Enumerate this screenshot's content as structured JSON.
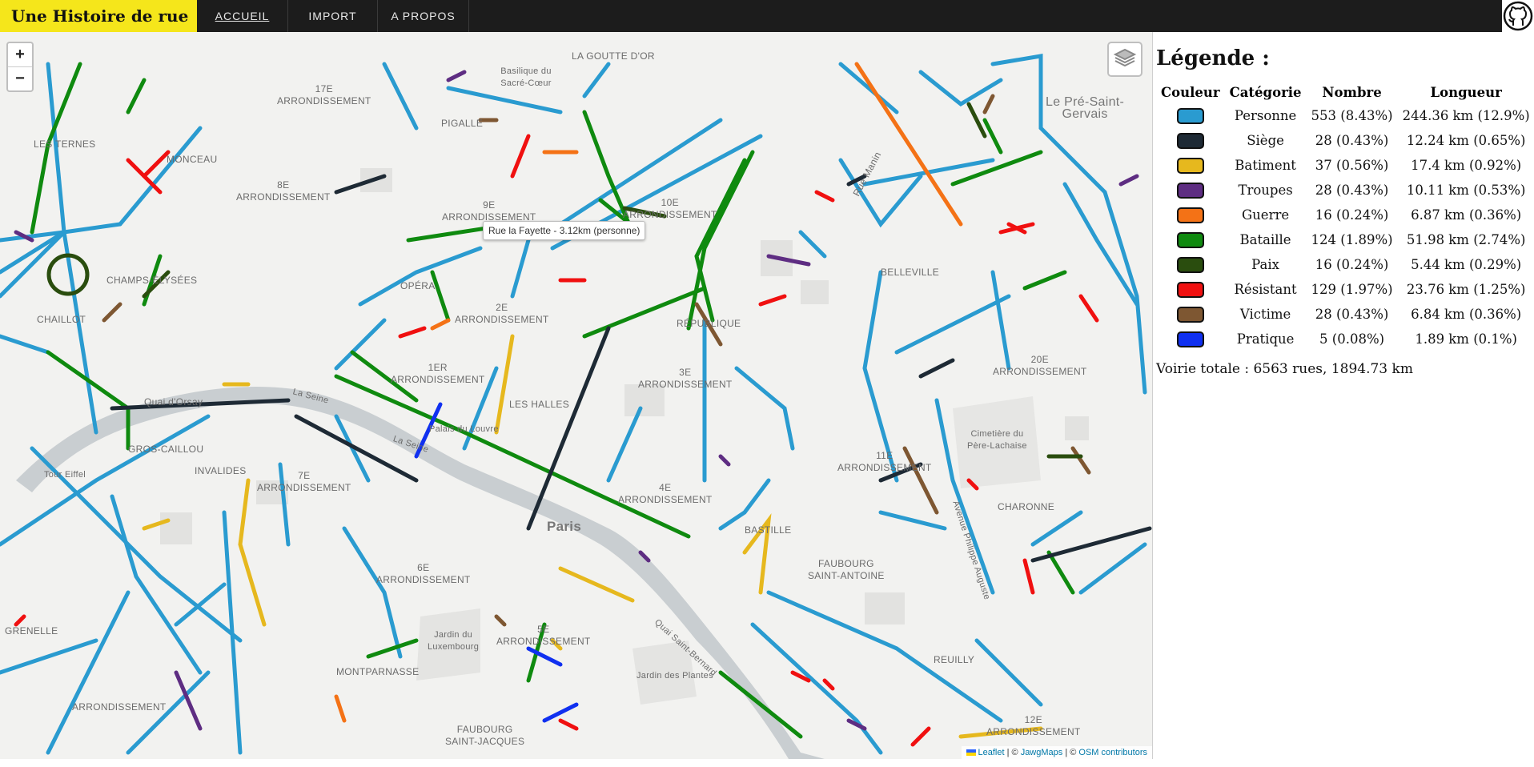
{
  "nav": {
    "brand": "Une Histoire de rue",
    "links": [
      "ACCUEIL",
      "IMPORT",
      "A PROPOS"
    ]
  },
  "map": {
    "zoom_in": "+",
    "zoom_out": "−",
    "tooltip": "Rue la Fayette - 3.12km (personne)",
    "attribution": {
      "leaflet": "Leaflet",
      "sep1": " | © ",
      "jawg": "JawgMaps",
      "sep2": " | © ",
      "osm": "OSM contributors"
    },
    "labels": {
      "goutte": "LA GOUTTE D'OR",
      "sacre_coeur": "Basilique du\nSacré-Cœur",
      "arr17": "17E\nARRONDISSEMENT",
      "pigalle": "PIGALLE",
      "ternes": "LES TERNES",
      "monceau": "MONCEAU",
      "arr8": "8E\nARRONDISSEMENT",
      "arr9": "9E\nARRONDISSEMENT",
      "arr10": "10E\nARRONDISSEMENT",
      "pre_st_gervais": "Le Pré-Saint-\nGervais",
      "rue_manin": "Rue Manin",
      "belleville": "BELLEVILLE",
      "champs": "CHAMPS-ÉLYSÉES",
      "opera": "OPÉRA",
      "arr2": "2E\nARRONDISSEMENT",
      "republique": "RÉPUBLIQUE",
      "chaillot": "CHAILLOT",
      "arr1": "1ER\nARRONDISSEMENT",
      "arr3": "3E\nARRONDISSEMENT",
      "arr20": "20E\nARRONDISSEMENT",
      "quai_orsay": "Quai d'Orsay",
      "la_seine": "La Seine",
      "la_seine2": "La Seine",
      "louvre": "Palais du Louvre",
      "halles": "LES HALLES",
      "pere_lachaise": "Cimetière du\nPère-Lachaise",
      "gros_caillou": "GROS-CAILLOU",
      "tour_eiffel": "Tour Eiffel",
      "invalides": "INVALIDES",
      "arr7": "7E\nARRONDISSEMENT",
      "arr11": "11E\nARRONDISSEMENT",
      "arr4": "4E\nARRONDISSEMENT",
      "philippe": "Avenue Philippe Auguste",
      "charonne": "CHARONNE",
      "paris": "Paris",
      "bastille": "BASTILLE",
      "arr6": "6E\nARRONDISSEMENT",
      "faubourg_st_antoine": "FAUBOURG\nSAINT-ANTOINE",
      "grenelle": "GRENELLE",
      "luxembourg": "Jardin du\nLuxembourg",
      "arr5": "5E\nARRONDISSEMENT",
      "quai_bernard": "Quai Saint-Bernard",
      "reuilly": "REUILLY",
      "montparnasse": "MONTPARNASSE",
      "jardin_plantes": "Jardin des Plantes",
      "arr15": "ARRONDISSEMENT",
      "faubourg_st_jacques": "FAUBOURG\nSAINT-JACQUES",
      "arr12": "12E\nARRONDISSEMENT"
    }
  },
  "legend": {
    "title": "Légende :",
    "headers": [
      "Couleur",
      "Catégorie",
      "Nombre",
      "Longueur"
    ],
    "rows": [
      {
        "color": "#2a9bd0",
        "category": "Personne",
        "count": "553 (8.43%)",
        "length": "244.36 km (12.9%)"
      },
      {
        "color": "#1e2a35",
        "category": "Siège",
        "count": "28 (0.43%)",
        "length": "12.24 km (0.65%)"
      },
      {
        "color": "#e6b81e",
        "category": "Batiment",
        "count": "37 (0.56%)",
        "length": "17.4 km (0.92%)"
      },
      {
        "color": "#5e2d82",
        "category": "Troupes",
        "count": "28 (0.43%)",
        "length": "10.11 km (0.53%)"
      },
      {
        "color": "#f47216",
        "category": "Guerre",
        "count": "16 (0.24%)",
        "length": "6.87 km (0.36%)"
      },
      {
        "color": "#0f8a0f",
        "category": "Bataille",
        "count": "124 (1.89%)",
        "length": "51.98 km (2.74%)"
      },
      {
        "color": "#2a4d0e",
        "category": "Paix",
        "count": "16 (0.24%)",
        "length": "5.44 km (0.29%)"
      },
      {
        "color": "#f01010",
        "category": "Résistant",
        "count": "129 (1.97%)",
        "length": "23.76 km (1.25%)"
      },
      {
        "color": "#7e5732",
        "category": "Victime",
        "count": "28 (0.43%)",
        "length": "6.84 km (0.36%)"
      },
      {
        "color": "#1030f0",
        "category": "Pratique",
        "count": "5 (0.08%)",
        "length": "1.89 km (0.1%)"
      }
    ],
    "total": "Voirie totale : 6563 rues, 1894.73 km"
  }
}
